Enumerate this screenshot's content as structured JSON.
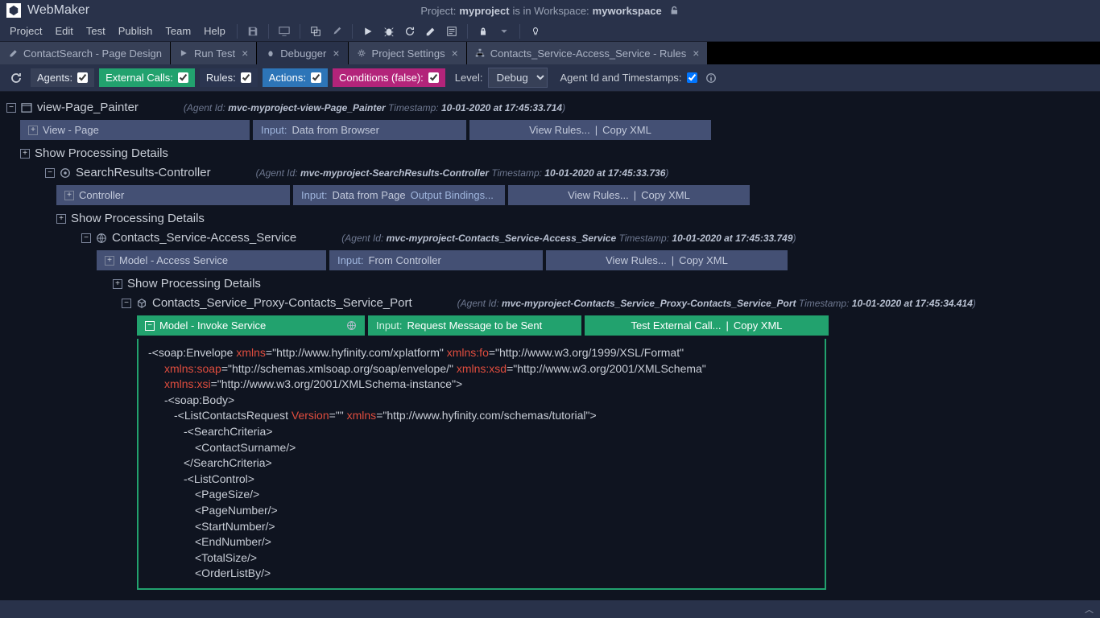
{
  "app": {
    "name": "WebMaker"
  },
  "project": {
    "prefix": "Project:",
    "name": "myproject",
    "mid": "is in Workspace:",
    "workspace": "myworkspace"
  },
  "menu": [
    "Project",
    "Edit",
    "Test",
    "Publish",
    "Team",
    "Help"
  ],
  "tabs": [
    {
      "label": "ContactSearch - Page Design",
      "closable": false
    },
    {
      "label": "Run Test",
      "closable": true
    },
    {
      "label": "Debugger",
      "closable": true
    },
    {
      "label": "Project Settings",
      "closable": true
    },
    {
      "label": "Contacts_Service-Access_Service - Rules",
      "closable": true
    }
  ],
  "filters": {
    "agents": "Agents:",
    "external": "External Calls:",
    "rules": "Rules:",
    "actions": "Actions:",
    "conditions": "Conditions (false):",
    "level": "Level:",
    "level_value": "Debug",
    "agent_ts": "Agent Id and Timestamps:"
  },
  "tree": {
    "n1": {
      "name": "view-Page_Painter",
      "meta_prefix": "(Agent Id:",
      "agent_id": "mvc-myproject-view-Page_Painter",
      "ts_label": "Timestamp:",
      "ts": "10-01-2020 at 17:45:33.714",
      "strip": {
        "a": "View - Page",
        "b_pre": "Input:",
        "b": "Data from Browser",
        "c1": "View Rules...",
        "c2": "Copy XML"
      }
    },
    "show_proc": "Show Processing Details",
    "n2": {
      "name": "SearchResults-Controller",
      "agent_id": "mvc-myproject-SearchResults-Controller",
      "ts": "10-01-2020 at 17:45:33.736",
      "strip": {
        "a": "Controller",
        "b_pre": "Input:",
        "b": "Data from Page",
        "b_link": "Output Bindings...",
        "c1": "View Rules...",
        "c2": "Copy XML"
      }
    },
    "n3": {
      "name": "Contacts_Service-Access_Service",
      "agent_id": "mvc-myproject-Contacts_Service-Access_Service",
      "ts": "10-01-2020 at 17:45:33.749",
      "strip": {
        "a": "Model - Access Service",
        "b_pre": "Input:",
        "b": "From Controller",
        "c1": "View Rules...",
        "c2": "Copy XML"
      }
    },
    "n4": {
      "name": "Contacts_Service_Proxy-Contacts_Service_Port",
      "agent_id": "mvc-myproject-Contacts_Service_Proxy-Contacts_Service_Port",
      "ts": "10-01-2020 at 17:45:34.414",
      "strip": {
        "a": "Model - Invoke Service",
        "b_pre": "Input:",
        "b": "Request Message to be Sent",
        "c1": "Test External Call...",
        "c2": "Copy XML"
      }
    }
  },
  "xml": {
    "l1_pre": "-<soap:Envelope ",
    "l1_a1": "xmlns",
    "l1_v1": "=\"http://www.hyfinity.com/xplatform\" ",
    "l1_a2": "xmlns:fo",
    "l1_v2": "=\"http://www.w3.org/1999/XSL/Format\"",
    "l2_a1": "xmlns:soap",
    "l2_v1": "=\"http://schemas.xmlsoap.org/soap/envelope/\" ",
    "l2_a2": "xmlns:xsd",
    "l2_v2": "=\"http://www.w3.org/2001/XMLSchema\"",
    "l3_a1": "xmlns:xsi",
    "l3_v1": "=\"http://www.w3.org/2001/XMLSchema-instance\">",
    "l4": "-<soap:Body>",
    "l5_pre": "-<ListContactsRequest ",
    "l5_a1": "Version",
    "l5_v1": "=\"\" ",
    "l5_a2": "xmlns",
    "l5_v2": "=\"http://www.hyfinity.com/schemas/tutorial\">",
    "l6": "-<SearchCriteria>",
    "l7": "<ContactSurname/>",
    "l8": "</SearchCriteria>",
    "l9": "-<ListControl>",
    "l10": "<PageSize/>",
    "l11": "<PageNumber/>",
    "l12": "<StartNumber/>",
    "l13": "<EndNumber/>",
    "l14": "<TotalSize/>",
    "l15": "<OrderListBy/>"
  }
}
